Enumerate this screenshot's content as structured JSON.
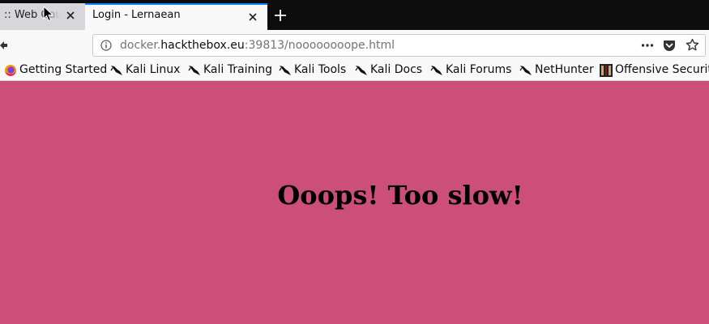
{
  "tabs": [
    {
      "title": ":: Web Gauntlet",
      "active": false
    },
    {
      "title": "Login - Lernaean",
      "active": true
    }
  ],
  "address_bar": {
    "url_prefix": "docker.",
    "url_host": "hackthebox.eu",
    "url_suffix": ":39813/noooooooope.html"
  },
  "bookmarks": [
    {
      "label": "Getting Started",
      "icon": "firefox-icon"
    },
    {
      "label": "Kali Linux",
      "icon": "kali-dragon-icon"
    },
    {
      "label": "Kali Training",
      "icon": "kali-dragon-icon"
    },
    {
      "label": "Kali Tools",
      "icon": "kali-dragon-icon"
    },
    {
      "label": "Kali Docs",
      "icon": "kali-dragon-icon"
    },
    {
      "label": "Kali Forums",
      "icon": "kali-dragon-icon"
    },
    {
      "label": "NetHunter",
      "icon": "kali-dragon-icon"
    },
    {
      "label": "Offensive Security",
      "icon": "offsec-icon"
    }
  ],
  "page": {
    "heading": "Ooops! Too slow!",
    "background_color": "#cb4f79"
  }
}
